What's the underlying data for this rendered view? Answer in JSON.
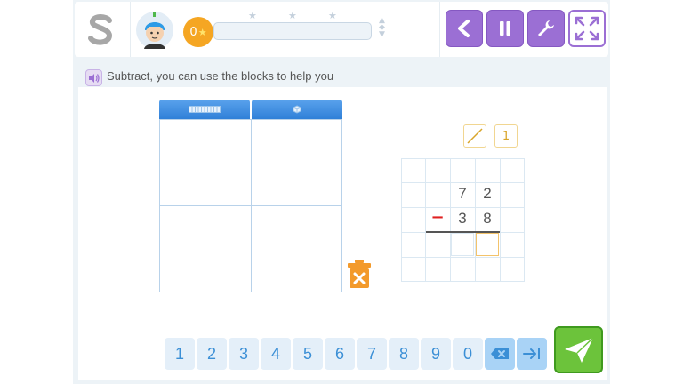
{
  "header": {
    "stars": "0",
    "controls": [
      "back",
      "pause",
      "settings",
      "fullscreen"
    ]
  },
  "instruction": "Subtract, you can use the blocks to help you",
  "blocks": {
    "columns": [
      "tens-rod",
      "unit-cube"
    ]
  },
  "fraction_tools": {
    "one_label": "1"
  },
  "problem": {
    "top": [
      "7",
      "2"
    ],
    "operator": "−",
    "bottom": [
      "3",
      "8"
    ]
  },
  "keypad": {
    "keys": [
      "1",
      "2",
      "3",
      "4",
      "5",
      "6",
      "7",
      "8",
      "9",
      "0"
    ]
  },
  "colors": {
    "accent": "#9b6fd4",
    "keypad_text": "#3b8fd6",
    "submit": "#6cc33b",
    "trash": "#f39a2b",
    "star_badge": "#f5a623"
  }
}
